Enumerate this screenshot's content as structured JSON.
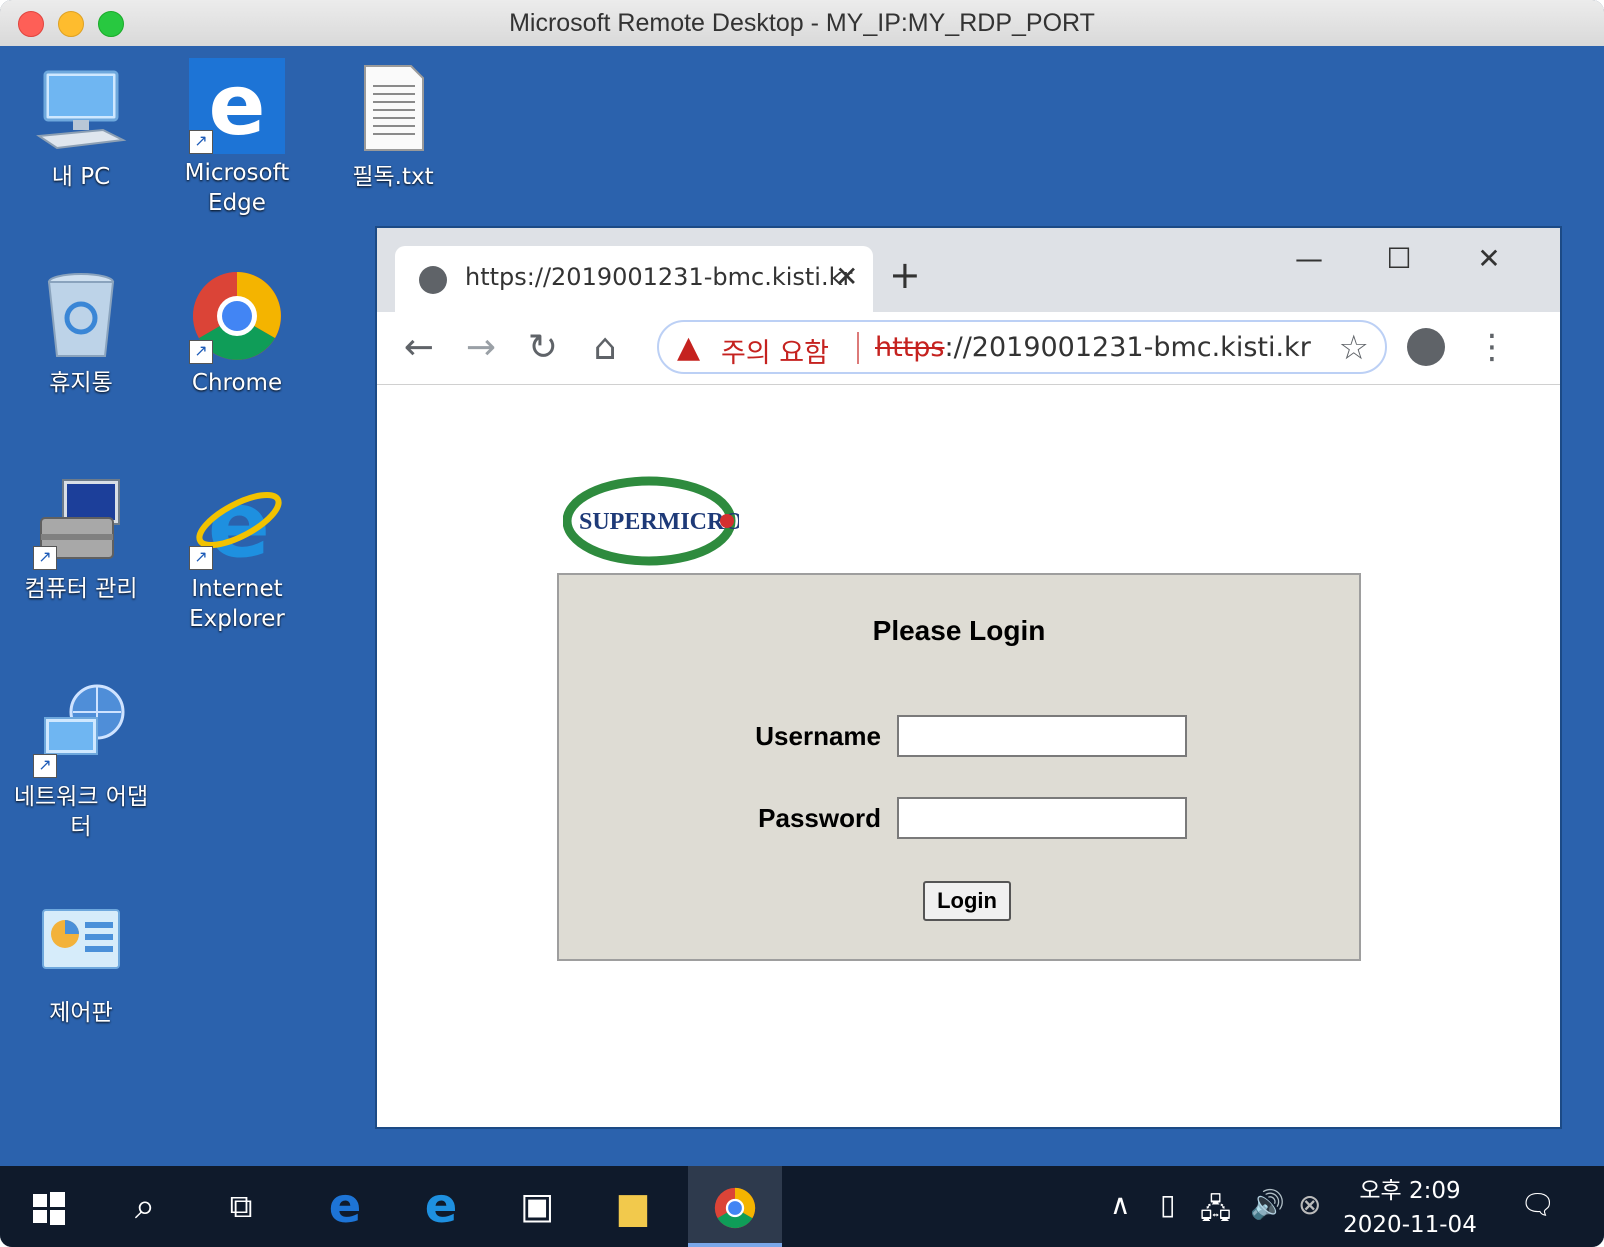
{
  "mac_window": {
    "title": "Microsoft Remote Desktop - MY_IP:MY_RDP_PORT"
  },
  "desktop": {
    "icons": [
      {
        "label": "내 PC"
      },
      {
        "label": "Microsoft Edge"
      },
      {
        "label": "필독.txt"
      },
      {
        "label": "휴지통"
      },
      {
        "label": "Chrome"
      },
      {
        "label": "컴퓨터 관리"
      },
      {
        "label": "Internet Explorer"
      },
      {
        "label": "네트워크 어댑터"
      },
      {
        "label": "제어판"
      }
    ]
  },
  "browser": {
    "tab": {
      "title": "https://2019001231-bmc.kisti.kr"
    },
    "omnibox": {
      "warning_text": "주의 요함",
      "url_scheme": "https",
      "url_rest": "://2019001231-bmc.kisti.kr"
    }
  },
  "page": {
    "logo_text": "SUPERMICRO",
    "login": {
      "title": "Please Login",
      "username_label": "Username",
      "password_label": "Password",
      "username_value": "",
      "password_value": "",
      "button_label": "Login"
    }
  },
  "taskbar": {
    "clock": {
      "time": "오후 2:09",
      "date": "2020-11-04"
    }
  },
  "colors": {
    "desktop_bg": "#2b62ad",
    "warning_red": "#c5221f",
    "login_panel": "#dedcd4",
    "taskbar_bg": "#0f1a2b"
  }
}
